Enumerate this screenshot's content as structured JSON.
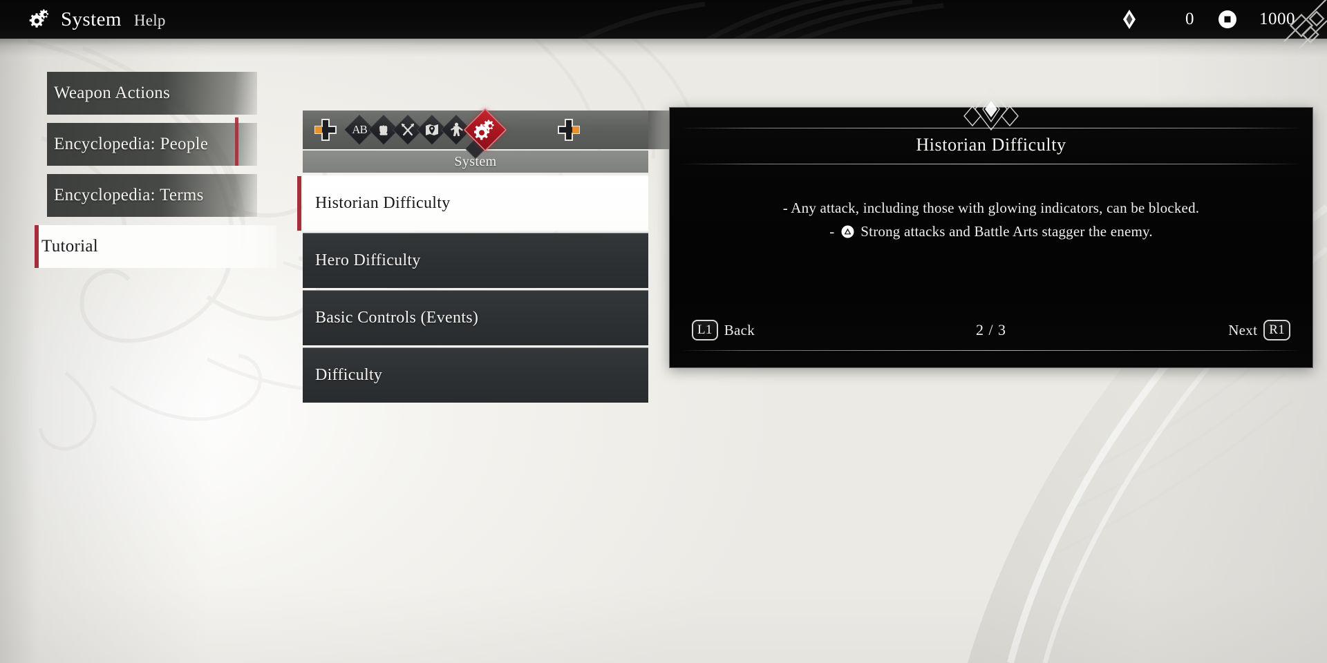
{
  "header": {
    "icon": "gears-icon",
    "title": "System",
    "subtitle": "Help",
    "gem_icon": "gem-icon",
    "gem_value": "0",
    "coin_icon": "coin-icon",
    "coin_value": "1000"
  },
  "sidebar": {
    "items": [
      {
        "label": "Weapon Actions",
        "selected": false
      },
      {
        "label": "Encyclopedia: People",
        "selected": false
      },
      {
        "label": "Encyclopedia: Terms",
        "selected": false
      },
      {
        "label": "Tutorial",
        "selected": true
      }
    ]
  },
  "tabbar": {
    "prev_icon": "dpad-left-icon",
    "next_icon": "dpad-right-icon",
    "active_label": "System",
    "tabs": [
      {
        "icon": "letters-ab-icon",
        "label": "AB",
        "active": false
      },
      {
        "icon": "fist-icon",
        "label": "",
        "active": false
      },
      {
        "icon": "crossed-swords-icon",
        "label": "",
        "active": false
      },
      {
        "icon": "map-pin-icon",
        "label": "",
        "active": false
      },
      {
        "icon": "warrior-icon",
        "label": "",
        "active": false
      },
      {
        "icon": "gears-icon",
        "label": "System",
        "active": true
      }
    ]
  },
  "list": {
    "rows": [
      {
        "label": "Historian Difficulty",
        "selected": true
      },
      {
        "label": "Hero Difficulty",
        "selected": false
      },
      {
        "label": "Basic Controls (Events)",
        "selected": false
      },
      {
        "label": "Difficulty",
        "selected": false
      }
    ]
  },
  "detail": {
    "ornament_icon": "diamond-ornament-icon",
    "title": "Historian Difficulty",
    "line1": "- Any attack, including those with glowing indicators, can be blocked.",
    "line2_prefix": "-",
    "line2_button": "triangle-button-icon",
    "line2_text": "Strong attacks and Battle Arts stagger the enemy.",
    "footer": {
      "back_button": "L1",
      "back_label": "Back",
      "page_indicator": "2 / 3",
      "next_label": "Next",
      "next_button": "R1"
    }
  },
  "colors": {
    "accent_red": "#a33038",
    "tab_active_red": "#a8151f",
    "dpad_highlight": "#e8922e",
    "background": "#f2f1ed",
    "panel_black": "#050505"
  }
}
